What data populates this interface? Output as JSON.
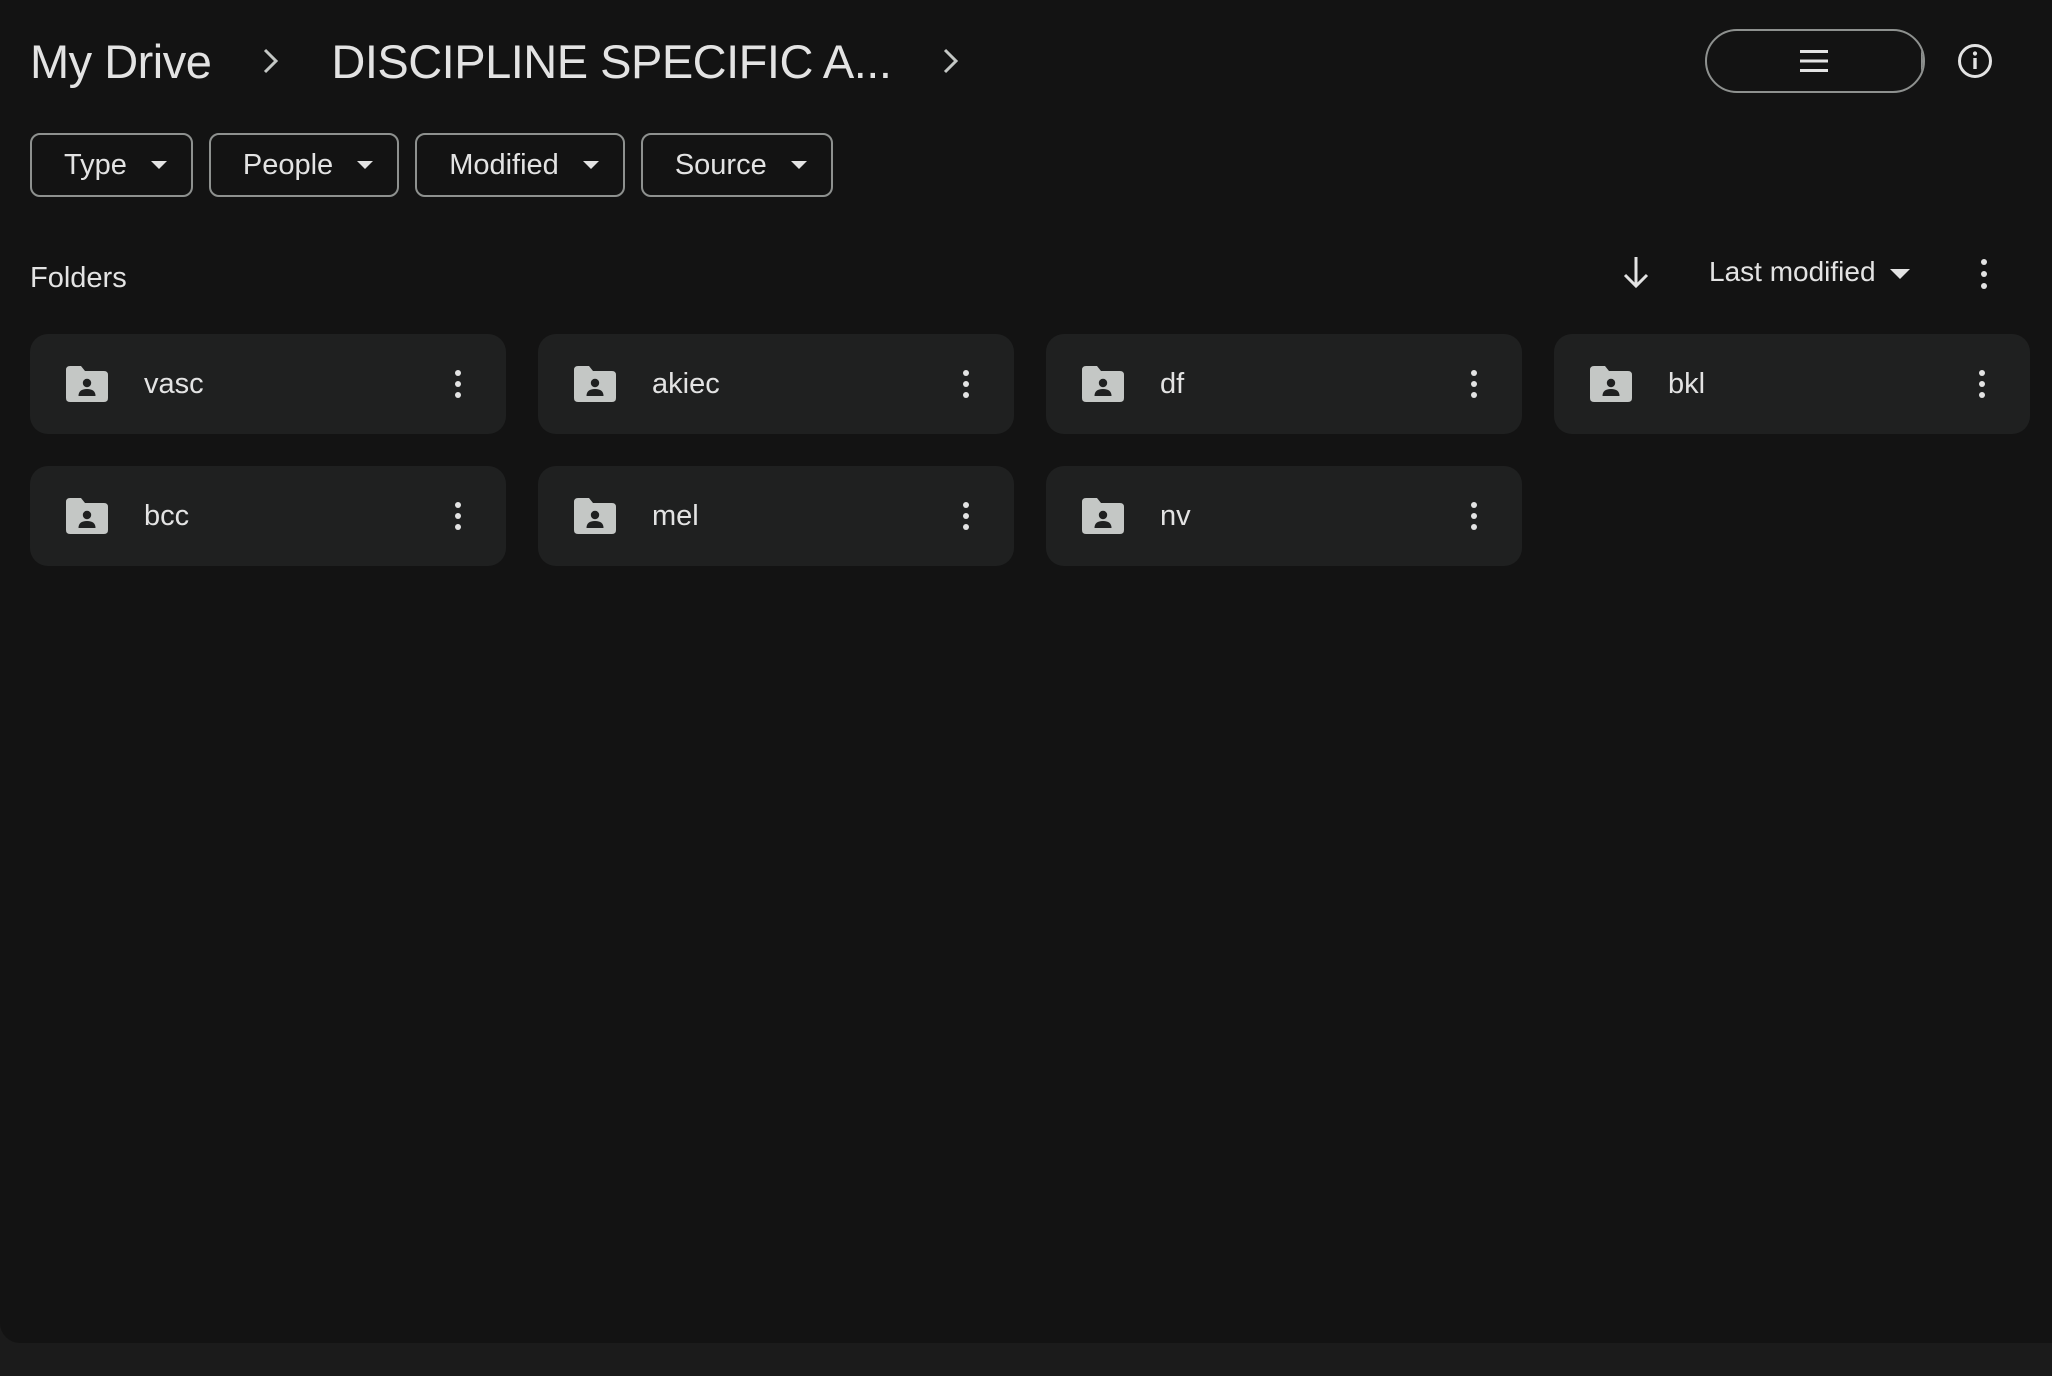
{
  "breadcrumb": {
    "root": "My Drive",
    "current": "DISCIPLINE SPECIFIC A..."
  },
  "view_toggle": {
    "list_icon": "list-view-icon",
    "grid_icon": "grid-view-icon",
    "selected": "grid",
    "selected_color": "#004a77"
  },
  "filters": [
    {
      "label": "Type"
    },
    {
      "label": "People"
    },
    {
      "label": "Modified"
    },
    {
      "label": "Source"
    }
  ],
  "section": {
    "title": "Folders",
    "sort_label": "Last modified",
    "sort_direction": "descending"
  },
  "folders": [
    {
      "name": "vasc"
    },
    {
      "name": "akiec"
    },
    {
      "name": "df"
    },
    {
      "name": "bkl"
    },
    {
      "name": "bcc"
    },
    {
      "name": "mel"
    },
    {
      "name": "nv"
    }
  ],
  "colors": {
    "background": "#131313",
    "card": "#1f2020",
    "text": "#e3e3e3",
    "outline": "#8e918f",
    "accent": "#004a77",
    "accent_icon": "#c2e7ff"
  }
}
